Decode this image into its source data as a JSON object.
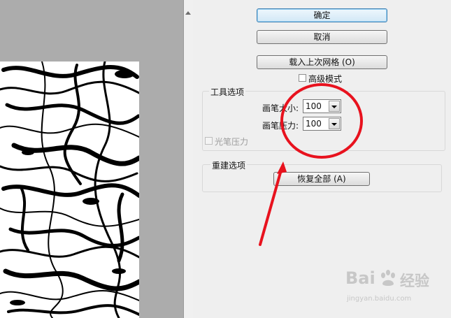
{
  "buttons": {
    "ok": "确定",
    "cancel": "取消",
    "load_mesh": "载入上次网格 (O)",
    "restore_all": "恢复全部 (A)"
  },
  "advanced_mode": {
    "label": "高级模式",
    "checked": false
  },
  "tool_options": {
    "title": "工具选项",
    "brush_size_label": "画笔大小:",
    "brush_size_value": "100",
    "brush_pressure_label": "画笔压力:",
    "brush_pressure_value": "100",
    "stylus_pressure_label": "光笔压力",
    "stylus_pressure_checked": false
  },
  "reconstruct_options": {
    "title": "重建选项"
  },
  "watermark": {
    "brand_latin": "Bai",
    "brand_cn": "经验",
    "url": "jingyan.baidu.com"
  },
  "colors": {
    "annotation": "#e8121e",
    "canvas_bg": "#acacac",
    "panel_bg": "#efefef"
  },
  "icons": {
    "watermark_logo": "baidu-paw-icon"
  }
}
